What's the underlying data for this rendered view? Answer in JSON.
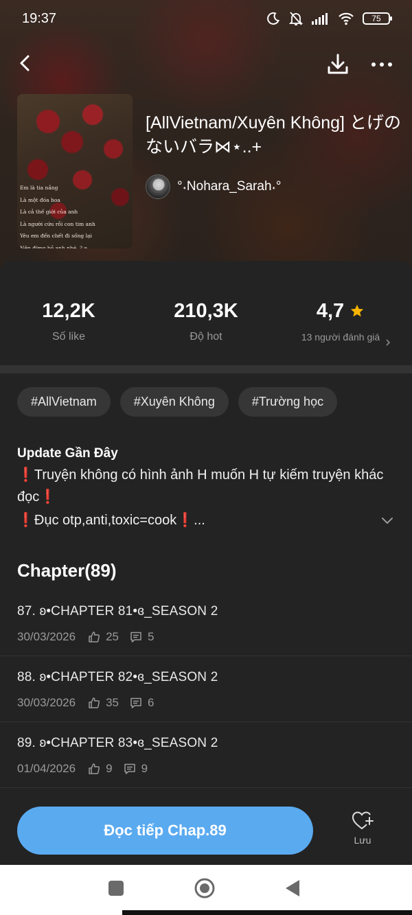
{
  "status_bar": {
    "time": "19:37",
    "battery": "75",
    "icons": [
      "moon-icon",
      "bell-off-icon",
      "signal-icon",
      "wifi-icon",
      "battery-icon"
    ]
  },
  "top_nav": {
    "icons": [
      "back-arrow-icon",
      "download-icon",
      "more-icon"
    ]
  },
  "story": {
    "title": "[AllVietnam/Xuyên Không] とげのないバラ⋈⋆..+",
    "author": "°˖Nohara_Sarah˖°",
    "cover_lines": [
      "Em là tia nắng",
      "Là một đóa hoa",
      "Là cả thế giới của anh",
      "Là người cứu rỗi con tim anh",
      "Yêu em đến chết đi sống lại",
      "Nên đừng bỏ anh nhé..? ʚ"
    ]
  },
  "stats": {
    "likes": {
      "value": "12,2K",
      "label": "Số like"
    },
    "hot": {
      "value": "210,3K",
      "label": "Độ hot"
    },
    "rating": {
      "value": "4,7",
      "label": "13 người đánh giá"
    }
  },
  "tags": [
    "#AllVietnam",
    "#Xuyên Không",
    "#Trường học"
  ],
  "update": {
    "title": "Update Gần Đây",
    "line1": "❗Truyện không có hình ảnh H muốn H tự kiếm truyện khác đọc❗",
    "line2": "❗Đục otp,anti,toxic=cook❗..."
  },
  "chapters": {
    "header": "Chapter(89)",
    "items": [
      {
        "title": "87. ʚ•CHAPTER 81•ɞ_SEASON 2",
        "date": "30/03/2026",
        "likes": "25",
        "comments": "5"
      },
      {
        "title": "88. ʚ•CHAPTER 82•ɞ_SEASON 2",
        "date": "30/03/2026",
        "likes": "35",
        "comments": "6"
      },
      {
        "title": "89. ʚ•CHAPTER 83•ɞ_SEASON 2",
        "date": "01/04/2026",
        "likes": "9",
        "comments": "9"
      }
    ]
  },
  "actions": {
    "read_label": "Đọc tiếp Chap.89",
    "save_label": "Lưu"
  },
  "colors": {
    "accent": "#5aaaf0",
    "star": "#f7b500",
    "panel": "#232323"
  }
}
